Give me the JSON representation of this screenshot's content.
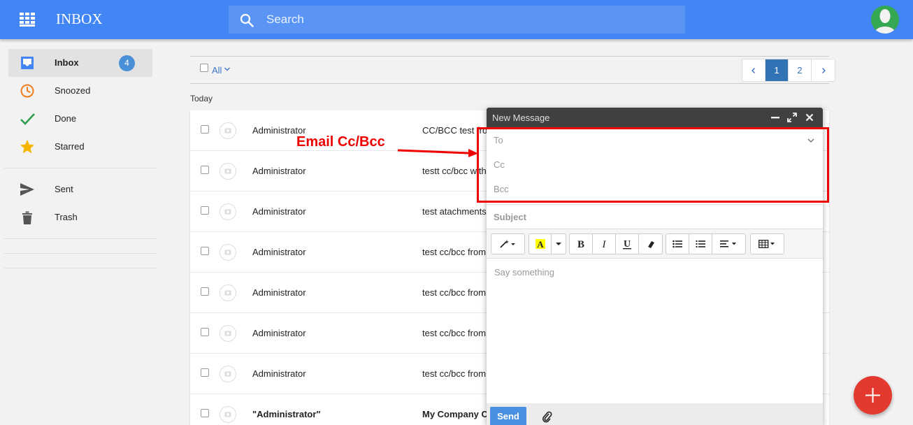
{
  "header": {
    "app_title": "INBOX",
    "search_placeholder": "Search",
    "brand_color": "#4285f4"
  },
  "sidebar": {
    "items": [
      {
        "label": "Inbox",
        "icon": "inbox-icon",
        "badge": "4",
        "active": true
      },
      {
        "label": "Snoozed",
        "icon": "clock-icon"
      },
      {
        "label": "Done",
        "icon": "check-icon"
      },
      {
        "label": "Starred",
        "icon": "star-icon"
      },
      {
        "label": "Sent",
        "icon": "send-icon"
      },
      {
        "label": "Trash",
        "icon": "trash-icon"
      }
    ]
  },
  "list": {
    "select_all_label": "All",
    "pages": [
      "1",
      "2"
    ],
    "current_page": "1",
    "section_label": "Today",
    "rows": [
      {
        "from": "Administrator",
        "subject": "CC/BCC test fro"
      },
      {
        "from": "Administrator",
        "subject": "testt cc/bcc with"
      },
      {
        "from": "Administrator",
        "subject": "test atachments"
      },
      {
        "from": "Administrator",
        "subject": "test cc/bcc from"
      },
      {
        "from": "Administrator",
        "subject": "test cc/bcc from"
      },
      {
        "from": "Administrator",
        "subject": "test cc/bcc from"
      },
      {
        "from": "Administrator",
        "subject": "test cc/bcc from"
      },
      {
        "from": "\"Administrator\"",
        "subject": "My Company C",
        "unread": true
      }
    ]
  },
  "compose": {
    "title": "New Message",
    "to_label": "To",
    "cc_label": "Cc",
    "bcc_label": "Bcc",
    "subject_label": "Subject",
    "body_placeholder": "Say something",
    "send_label": "Send"
  },
  "annotation": {
    "label": "Email Cc/Bcc",
    "color": "#e00000"
  }
}
